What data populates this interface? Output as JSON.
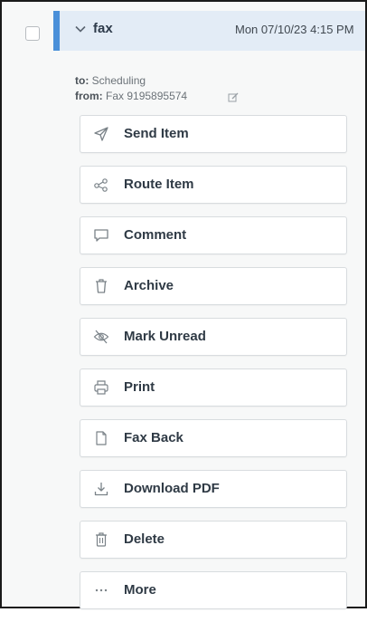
{
  "message": {
    "subject": "fax",
    "date": "Mon 07/10/23 4:15 PM",
    "to_label": "to:",
    "to_value": "Scheduling",
    "from_label": "from:",
    "from_value": "Fax 9195895574"
  },
  "actions": [
    {
      "label": "Send Item",
      "icon": "send-icon"
    },
    {
      "label": "Route Item",
      "icon": "route-icon"
    },
    {
      "label": "Comment",
      "icon": "comment-icon"
    },
    {
      "label": "Archive",
      "icon": "archive-icon"
    },
    {
      "label": "Mark Unread",
      "icon": "eye-off-icon"
    },
    {
      "label": "Print",
      "icon": "print-icon"
    },
    {
      "label": "Fax Back",
      "icon": "document-icon"
    },
    {
      "label": "Download PDF",
      "icon": "download-icon"
    },
    {
      "label": "Delete",
      "icon": "trash-icon"
    },
    {
      "label": "More",
      "icon": "ellipsis-icon"
    }
  ]
}
